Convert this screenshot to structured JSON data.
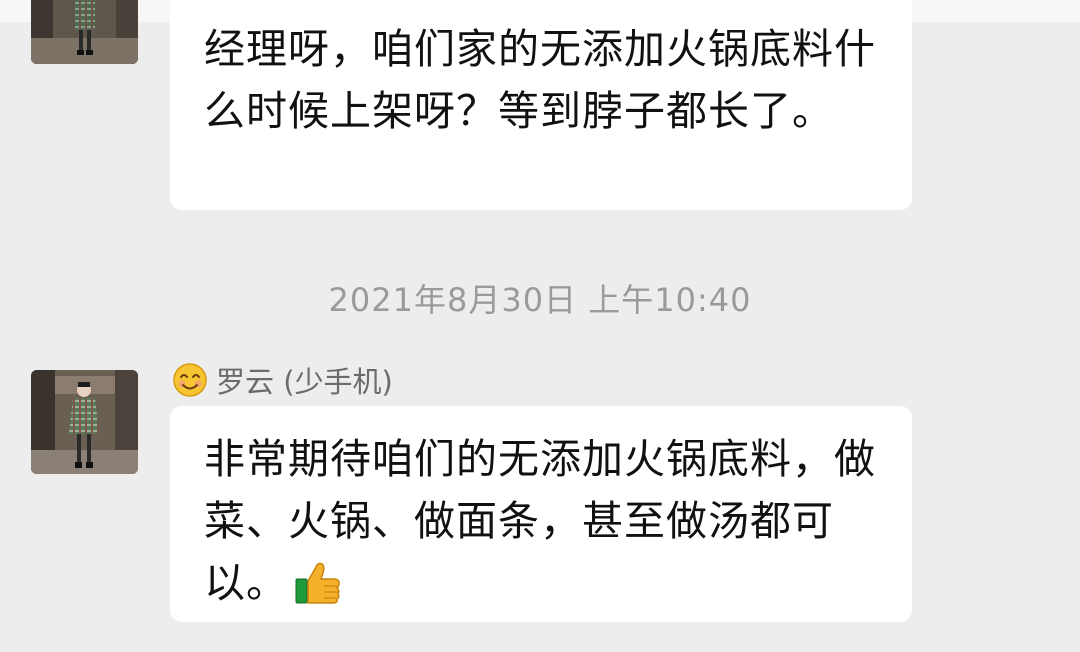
{
  "messages": [
    {
      "text": "经理呀，咱们家的无添加火锅底料什么时候上架呀？等到脖子都长了。"
    },
    {
      "sender_emoji": "smiling-face-icon",
      "sender_name": "罗云 (少手机)",
      "text": "非常期待咱们的无添加火锅底料，做菜、火锅、做面条，甚至做汤都可以。",
      "trailing_emoji": "thumbs-up-icon"
    }
  ],
  "timestamp": "2021年8月30日 上午10:40",
  "colors": {
    "background": "#ededed",
    "bubble": "#ffffff",
    "text": "#111111",
    "timestamp": "#9a9a9a",
    "sender_name": "#6b6b6b"
  }
}
